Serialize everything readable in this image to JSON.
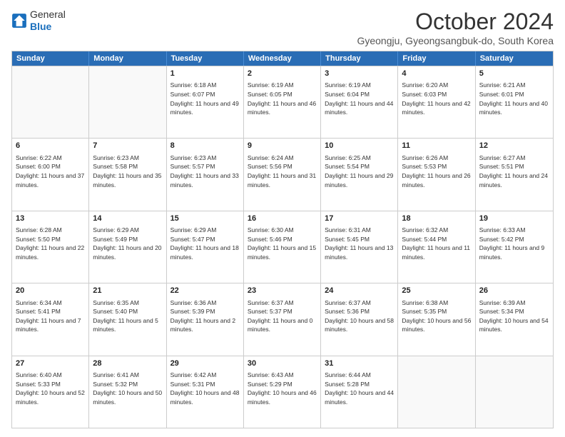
{
  "logo": {
    "general": "General",
    "blue": "Blue"
  },
  "title": "October 2024",
  "location": "Gyeongju, Gyeongsangbuk-do, South Korea",
  "weekdays": [
    "Sunday",
    "Monday",
    "Tuesday",
    "Wednesday",
    "Thursday",
    "Friday",
    "Saturday"
  ],
  "weeks": [
    [
      {
        "day": "",
        "text": "",
        "empty": true
      },
      {
        "day": "",
        "text": "",
        "empty": true
      },
      {
        "day": "1",
        "text": "Sunrise: 6:18 AM\nSunset: 6:07 PM\nDaylight: 11 hours and 49 minutes."
      },
      {
        "day": "2",
        "text": "Sunrise: 6:19 AM\nSunset: 6:05 PM\nDaylight: 11 hours and 46 minutes."
      },
      {
        "day": "3",
        "text": "Sunrise: 6:19 AM\nSunset: 6:04 PM\nDaylight: 11 hours and 44 minutes."
      },
      {
        "day": "4",
        "text": "Sunrise: 6:20 AM\nSunset: 6:03 PM\nDaylight: 11 hours and 42 minutes."
      },
      {
        "day": "5",
        "text": "Sunrise: 6:21 AM\nSunset: 6:01 PM\nDaylight: 11 hours and 40 minutes."
      }
    ],
    [
      {
        "day": "6",
        "text": "Sunrise: 6:22 AM\nSunset: 6:00 PM\nDaylight: 11 hours and 37 minutes."
      },
      {
        "day": "7",
        "text": "Sunrise: 6:23 AM\nSunset: 5:58 PM\nDaylight: 11 hours and 35 minutes."
      },
      {
        "day": "8",
        "text": "Sunrise: 6:23 AM\nSunset: 5:57 PM\nDaylight: 11 hours and 33 minutes."
      },
      {
        "day": "9",
        "text": "Sunrise: 6:24 AM\nSunset: 5:56 PM\nDaylight: 11 hours and 31 minutes."
      },
      {
        "day": "10",
        "text": "Sunrise: 6:25 AM\nSunset: 5:54 PM\nDaylight: 11 hours and 29 minutes."
      },
      {
        "day": "11",
        "text": "Sunrise: 6:26 AM\nSunset: 5:53 PM\nDaylight: 11 hours and 26 minutes."
      },
      {
        "day": "12",
        "text": "Sunrise: 6:27 AM\nSunset: 5:51 PM\nDaylight: 11 hours and 24 minutes."
      }
    ],
    [
      {
        "day": "13",
        "text": "Sunrise: 6:28 AM\nSunset: 5:50 PM\nDaylight: 11 hours and 22 minutes."
      },
      {
        "day": "14",
        "text": "Sunrise: 6:29 AM\nSunset: 5:49 PM\nDaylight: 11 hours and 20 minutes."
      },
      {
        "day": "15",
        "text": "Sunrise: 6:29 AM\nSunset: 5:47 PM\nDaylight: 11 hours and 18 minutes."
      },
      {
        "day": "16",
        "text": "Sunrise: 6:30 AM\nSunset: 5:46 PM\nDaylight: 11 hours and 15 minutes."
      },
      {
        "day": "17",
        "text": "Sunrise: 6:31 AM\nSunset: 5:45 PM\nDaylight: 11 hours and 13 minutes."
      },
      {
        "day": "18",
        "text": "Sunrise: 6:32 AM\nSunset: 5:44 PM\nDaylight: 11 hours and 11 minutes."
      },
      {
        "day": "19",
        "text": "Sunrise: 6:33 AM\nSunset: 5:42 PM\nDaylight: 11 hours and 9 minutes."
      }
    ],
    [
      {
        "day": "20",
        "text": "Sunrise: 6:34 AM\nSunset: 5:41 PM\nDaylight: 11 hours and 7 minutes."
      },
      {
        "day": "21",
        "text": "Sunrise: 6:35 AM\nSunset: 5:40 PM\nDaylight: 11 hours and 5 minutes."
      },
      {
        "day": "22",
        "text": "Sunrise: 6:36 AM\nSunset: 5:39 PM\nDaylight: 11 hours and 2 minutes."
      },
      {
        "day": "23",
        "text": "Sunrise: 6:37 AM\nSunset: 5:37 PM\nDaylight: 11 hours and 0 minutes."
      },
      {
        "day": "24",
        "text": "Sunrise: 6:37 AM\nSunset: 5:36 PM\nDaylight: 10 hours and 58 minutes."
      },
      {
        "day": "25",
        "text": "Sunrise: 6:38 AM\nSunset: 5:35 PM\nDaylight: 10 hours and 56 minutes."
      },
      {
        "day": "26",
        "text": "Sunrise: 6:39 AM\nSunset: 5:34 PM\nDaylight: 10 hours and 54 minutes."
      }
    ],
    [
      {
        "day": "27",
        "text": "Sunrise: 6:40 AM\nSunset: 5:33 PM\nDaylight: 10 hours and 52 minutes."
      },
      {
        "day": "28",
        "text": "Sunrise: 6:41 AM\nSunset: 5:32 PM\nDaylight: 10 hours and 50 minutes."
      },
      {
        "day": "29",
        "text": "Sunrise: 6:42 AM\nSunset: 5:31 PM\nDaylight: 10 hours and 48 minutes."
      },
      {
        "day": "30",
        "text": "Sunrise: 6:43 AM\nSunset: 5:29 PM\nDaylight: 10 hours and 46 minutes."
      },
      {
        "day": "31",
        "text": "Sunrise: 6:44 AM\nSunset: 5:28 PM\nDaylight: 10 hours and 44 minutes."
      },
      {
        "day": "",
        "text": "",
        "empty": true
      },
      {
        "day": "",
        "text": "",
        "empty": true
      }
    ]
  ]
}
